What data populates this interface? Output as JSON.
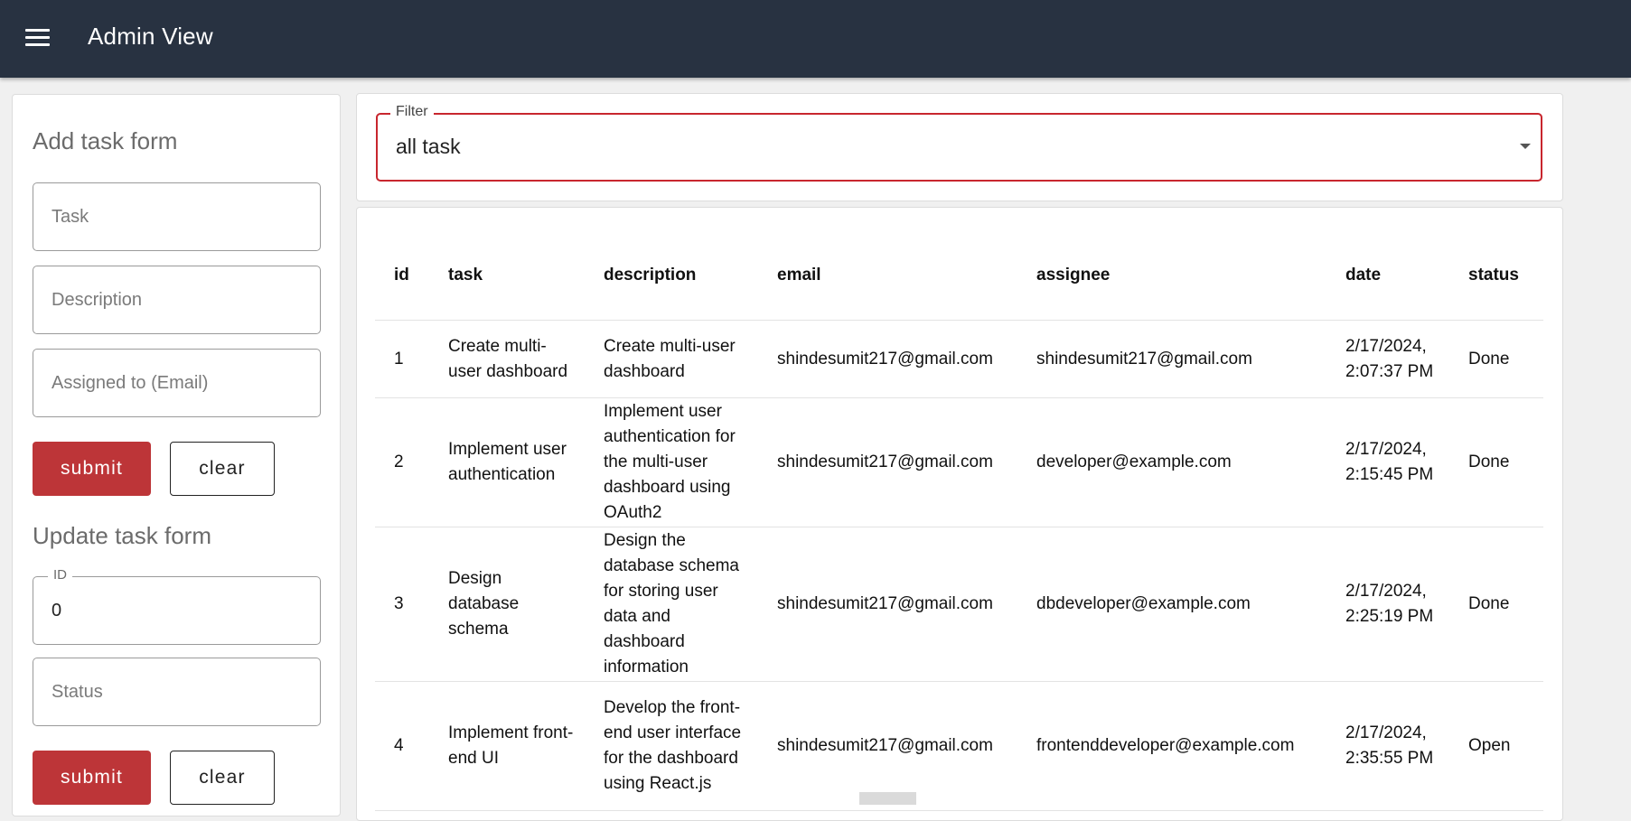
{
  "header": {
    "title": "Admin View"
  },
  "add_form": {
    "heading": "Add task form",
    "task_placeholder": "Task",
    "description_placeholder": "Description",
    "assigned_placeholder": "Assigned to (Email)",
    "submit_label": "submit",
    "clear_label": "clear"
  },
  "update_form": {
    "heading": "Update task form",
    "id_label": "ID",
    "id_value": "0",
    "status_placeholder": "Status",
    "submit_label": "submit",
    "clear_label": "clear"
  },
  "filter": {
    "label": "Filter",
    "value": "all task"
  },
  "table": {
    "columns": [
      "id",
      "task",
      "description",
      "email",
      "assignee",
      "date",
      "status"
    ],
    "rows": [
      {
        "id": "1",
        "task": "Create multi-user dashboard",
        "description": "Create multi-user dashboard",
        "email": "shindesumit217@gmail.com",
        "assignee": "shindesumit217@gmail.com",
        "date": "2/17/2024, 2:07:37 PM",
        "status": "Done"
      },
      {
        "id": "2",
        "task": "Implement user authentication",
        "description": "Implement user authentication for the multi-user dashboard using OAuth2",
        "email": "shindesumit217@gmail.com",
        "assignee": "developer@example.com",
        "date": "2/17/2024, 2:15:45 PM",
        "status": "Done"
      },
      {
        "id": "3",
        "task": "Design database schema",
        "description": "Design the database schema for storing user data and dashboard information",
        "email": "shindesumit217@gmail.com",
        "assignee": "dbdeveloper@example.com",
        "date": "2/17/2024, 2:25:19 PM",
        "status": "Done"
      },
      {
        "id": "4",
        "task": "Implement front-end UI",
        "description": "Develop the front-end user interface for the dashboard using React.js",
        "email": "shindesumit217@gmail.com",
        "assignee": "frontenddeveloper@example.com",
        "date": "2/17/2024, 2:35:55 PM",
        "status": "Open"
      }
    ]
  },
  "colors": {
    "appbar": "#283241",
    "accent": "#bd3538",
    "filter_border": "#c8262e"
  },
  "icons": {
    "menu": "hamburger-menu-icon",
    "dropdown": "caret-down-icon"
  }
}
